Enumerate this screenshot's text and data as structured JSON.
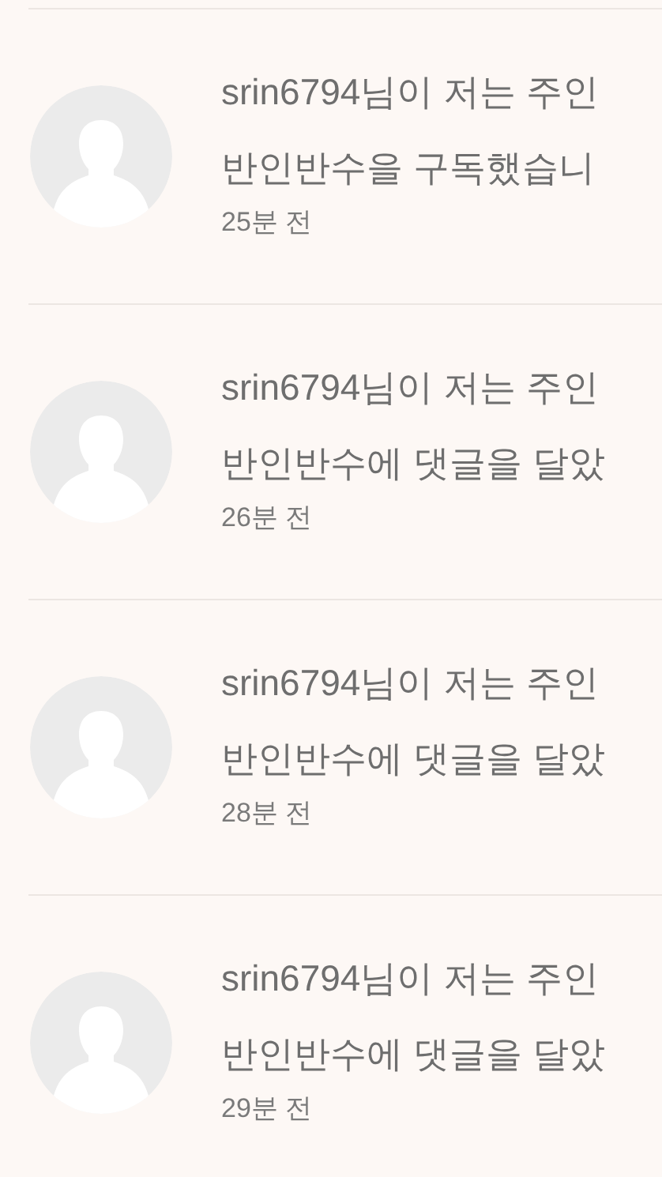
{
  "notifications": [
    {
      "line_1": "srin6794님이 저는 주인",
      "line_2": "반인반수을 구독했습니",
      "time": "25분 전"
    },
    {
      "line_1": "srin6794님이 저는 주인",
      "line_2": "반인반수에 댓글을 달았",
      "time": "26분 전"
    },
    {
      "line_1": "srin6794님이 저는 주인",
      "line_2": "반인반수에 댓글을 달았",
      "time": "28분 전"
    },
    {
      "line_1": "srin6794님이 저는 주인",
      "line_2": "반인반수에 댓글을 달았",
      "time": "29분 전"
    }
  ]
}
